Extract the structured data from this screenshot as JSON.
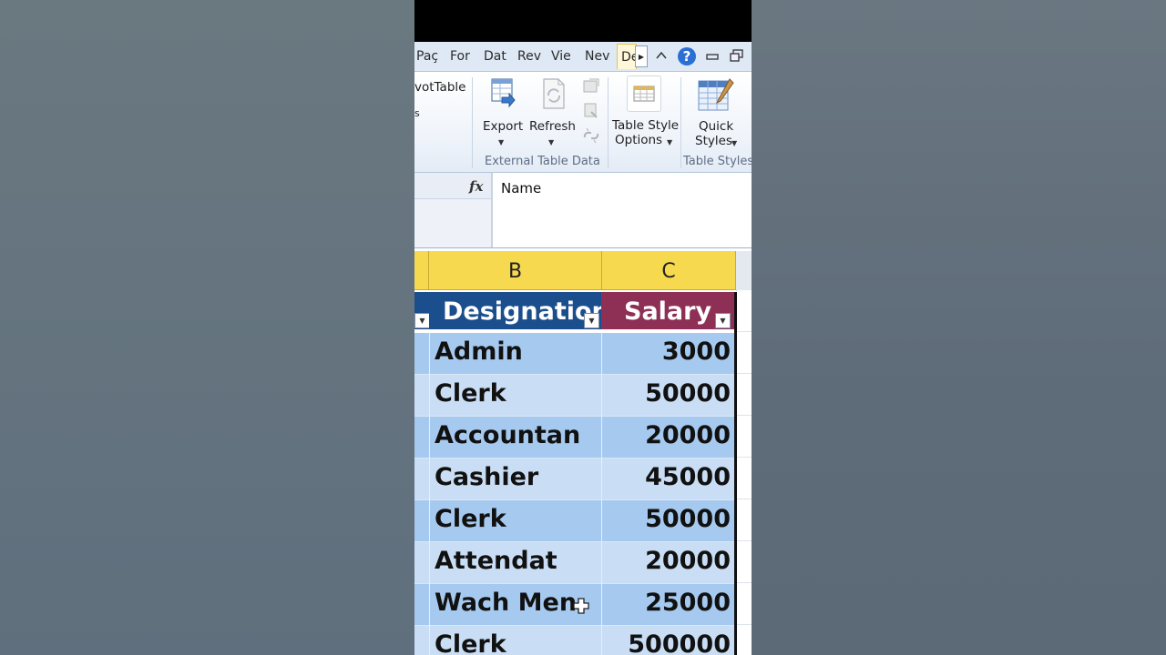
{
  "ribbon": {
    "tabs": [
      "Paç",
      "For",
      "Dat",
      "Rev",
      "Vie",
      "Nev",
      "De"
    ],
    "left_label_1": "votTable",
    "left_label_2": "s",
    "export_label": "Export",
    "refresh_label": "Refresh",
    "table_style_options_line1": "Table Style",
    "table_style_options_line2": "Options",
    "quick_styles_line1": "Quick",
    "quick_styles_line2": "Styles",
    "group_external": "External Table Data",
    "group_styles": "Table Styles"
  },
  "formula_bar": {
    "fx": "fx",
    "value": "Name"
  },
  "columns": {
    "b": "B",
    "c": "C"
  },
  "table": {
    "headers": {
      "designation": "Designation",
      "salary": "Salary"
    },
    "rows": [
      {
        "designation": "Admin",
        "salary": "3000"
      },
      {
        "designation": "Clerk",
        "salary": "50000"
      },
      {
        "designation": "Accountan",
        "salary": "20000"
      },
      {
        "designation": "Cashier",
        "salary": "45000"
      },
      {
        "designation": "Clerk",
        "salary": "50000"
      },
      {
        "designation": "Attendat",
        "salary": "20000"
      },
      {
        "designation": "Wach Men",
        "salary": "25000"
      },
      {
        "designation": "Clerk",
        "salary": "500000"
      }
    ]
  },
  "colors": {
    "header_blue": "#1b4e8c",
    "header_maroon": "#8e3055",
    "row_dark": "#a6c9ef",
    "row_light": "#c9def5",
    "col_header_yellow": "#f6d94e"
  }
}
